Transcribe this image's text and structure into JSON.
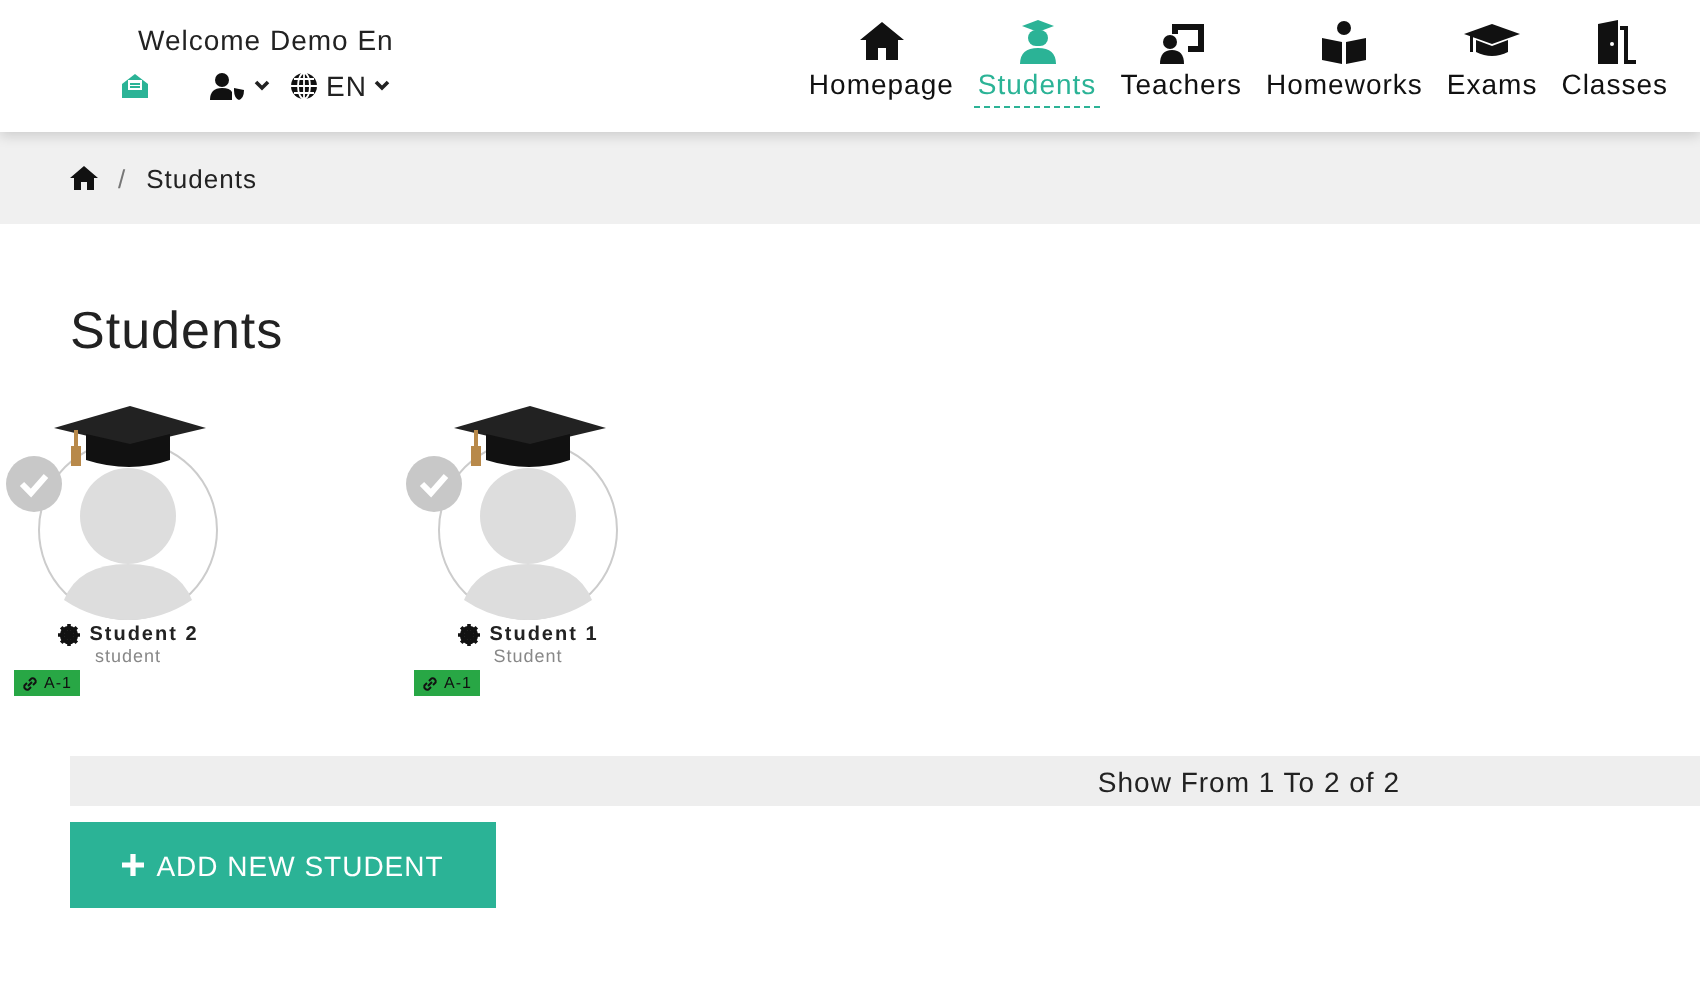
{
  "header": {
    "welcome": "Welcome Demo En",
    "language": "EN"
  },
  "nav": [
    {
      "kind": "home",
      "label": "Homepage",
      "selected": false
    },
    {
      "kind": "student",
      "label": "Students",
      "selected": true
    },
    {
      "kind": "teacher",
      "label": "Teachers",
      "selected": false
    },
    {
      "kind": "book",
      "label": "Homeworks",
      "selected": false
    },
    {
      "kind": "cap",
      "label": "Exams",
      "selected": false
    },
    {
      "kind": "door",
      "label": "Classes",
      "selected": false
    }
  ],
  "breadcrumb": [
    {
      "separator": "/",
      "label": "Students"
    }
  ],
  "page_title": "Students",
  "students": [
    {
      "name": "Student 2",
      "role": "student",
      "class": "A-1"
    },
    {
      "name": "Student 1",
      "role": "Student",
      "class": "A-1"
    }
  ],
  "pagination": "Show From 1 To 2 of 2",
  "add_button": "ADD NEW STUDENT"
}
